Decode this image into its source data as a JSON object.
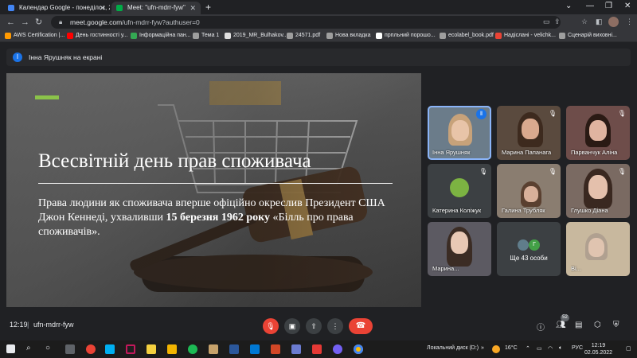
{
  "browser": {
    "tabs": [
      {
        "title": "Календар Google - понеділок, 2",
        "fav_color": "#4285f4"
      },
      {
        "title": "Meet: \"ufn-mdrr-fyw\"",
        "fav_color": "#00ac47"
      }
    ],
    "new_tab": "+",
    "window_controls": {
      "minimize": "—",
      "maximize": "❐",
      "close": "✕"
    },
    "url_host": "meet.google.com",
    "url_path": "/ufn-mdrr-fyw?authuser=0",
    "bookmarks": [
      {
        "label": "AWS Certification |...",
        "color": "#ff9900"
      },
      {
        "label": "День гостинності у...",
        "color": "#ff0000"
      },
      {
        "label": "Інформаційна пан...",
        "color": "#34a853"
      },
      {
        "label": "Тема 1",
        "color": "#9e9e9e"
      },
      {
        "label": "2019_MR_Bulhakov...",
        "color": "#e0e0e0"
      },
      {
        "label": "24571.pdf",
        "color": "#9e9e9e"
      },
      {
        "label": "Нова вкладка",
        "color": "#9e9e9e"
      },
      {
        "label": "прпльний порошо...",
        "color": "#ffffff"
      },
      {
        "label": "ecolabel_book.pdf",
        "color": "#9e9e9e"
      },
      {
        "label": "Надіслані - velichk...",
        "color": "#ea4335"
      },
      {
        "label": "Сценарій виховні...",
        "color": "#9e9e9e"
      }
    ]
  },
  "meet": {
    "banner_text": "Інна Ярушняк на екрані",
    "banner_icon": "I",
    "slide": {
      "title": "Всесвітній день прав споживача",
      "body_part1": "Права людини як споживача вперше офіційно окреслив Президент США Джон Кеннеді, ухваливши ",
      "body_bold": "15 березня 1962 року",
      "body_part2": " «Білль про права споживачів».",
      "accent_color": "#8bc34a"
    },
    "participants": [
      {
        "name": "Інна Ярушняк",
        "speaking": true
      },
      {
        "name": "Марина Папанага",
        "speaking": false
      },
      {
        "name": "Парванчук Аліна",
        "speaking": false
      },
      {
        "name": "Катерина Коліжук",
        "speaking": false
      },
      {
        "name": "Галина Трубляк",
        "speaking": false
      },
      {
        "name": "Глушко Діана",
        "speaking": false
      },
      {
        "name": "Марина...",
        "speaking": false
      },
      {
        "name": "Ще 43 особи",
        "speaking": false
      },
      {
        "name": "Ві...",
        "speaking": false
      }
    ],
    "more_avatar_letter": "Г",
    "meeting_time": "12:19",
    "separator": "|",
    "meeting_code": "ufn-mdrr-fyw",
    "people_count": "52"
  },
  "taskbar": {
    "disk_label": "Локальний диск (D:)",
    "weather": "16°C",
    "language": "РУС",
    "time": "12:19",
    "date": "02.05.2022"
  }
}
